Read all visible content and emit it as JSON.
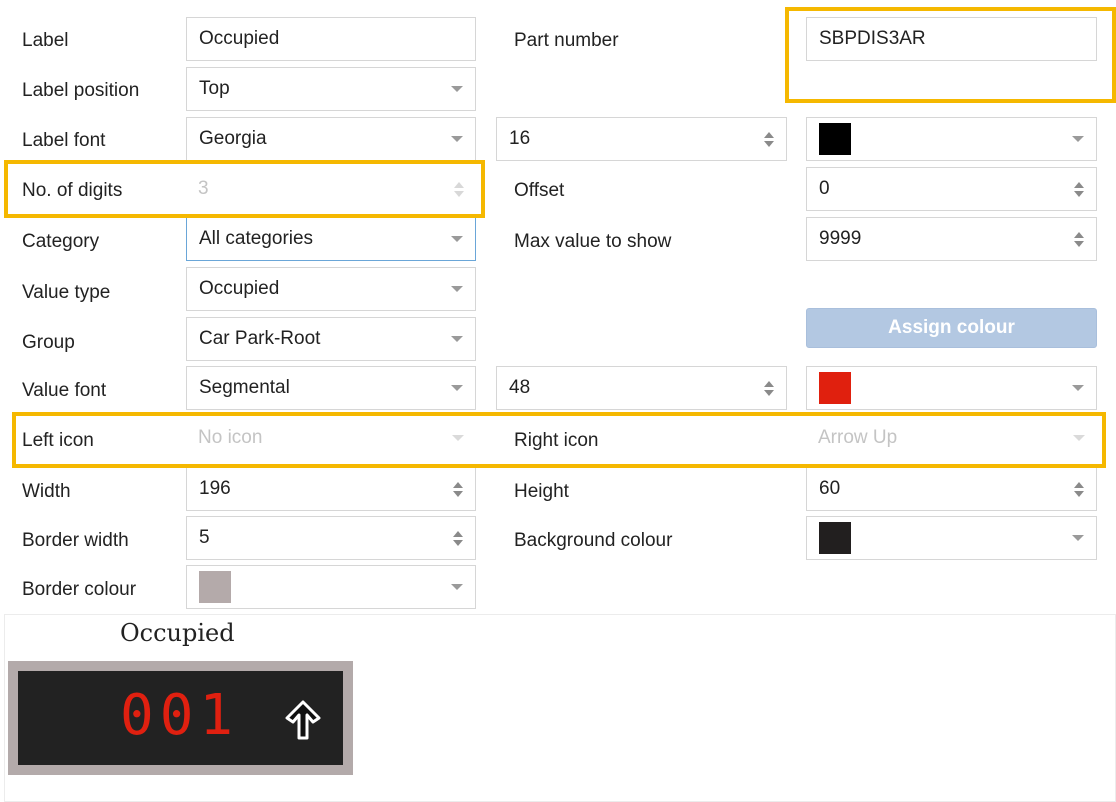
{
  "fields": {
    "label": {
      "label": "Label",
      "value": "Occupied"
    },
    "label_position": {
      "label": "Label position",
      "value": "Top"
    },
    "label_font": {
      "label": "Label font",
      "value": "Georgia",
      "size": "16",
      "color": "#000000"
    },
    "num_digits": {
      "label": "No. of digits",
      "value": "3"
    },
    "category": {
      "label": "Category",
      "value": "All categories"
    },
    "value_type": {
      "label": "Value type",
      "value": "Occupied"
    },
    "group": {
      "label": "Group",
      "value": "Car Park-Root"
    },
    "value_font": {
      "label": "Value font",
      "value": "Segmental",
      "size": "48",
      "color": "#e0200e"
    },
    "left_icon": {
      "label": "Left icon",
      "value": "No icon"
    },
    "width": {
      "label": "Width",
      "value": "196"
    },
    "border_width": {
      "label": "Border width",
      "value": "5"
    },
    "border_colour": {
      "label": "Border colour",
      "color": "#b4aaaa"
    },
    "part_number": {
      "label": "Part number",
      "value": "SBPDIS3AR"
    },
    "offset": {
      "label": "Offset",
      "value": "0"
    },
    "max_value": {
      "label": "Max value to show",
      "value": "9999"
    },
    "right_icon": {
      "label": "Right icon",
      "value": "Arrow Up"
    },
    "height": {
      "label": "Height",
      "value": "60"
    },
    "background_colour": {
      "label": "Background colour",
      "color": "#221f1f"
    }
  },
  "assign_colour_button": "Assign colour",
  "preview": {
    "label": "Occupied",
    "digits": "001",
    "icon": "arrow-up-icon"
  },
  "colors": {
    "highlight": "#f5b800",
    "button": "#b3c8e2",
    "digit": "#e02010"
  }
}
